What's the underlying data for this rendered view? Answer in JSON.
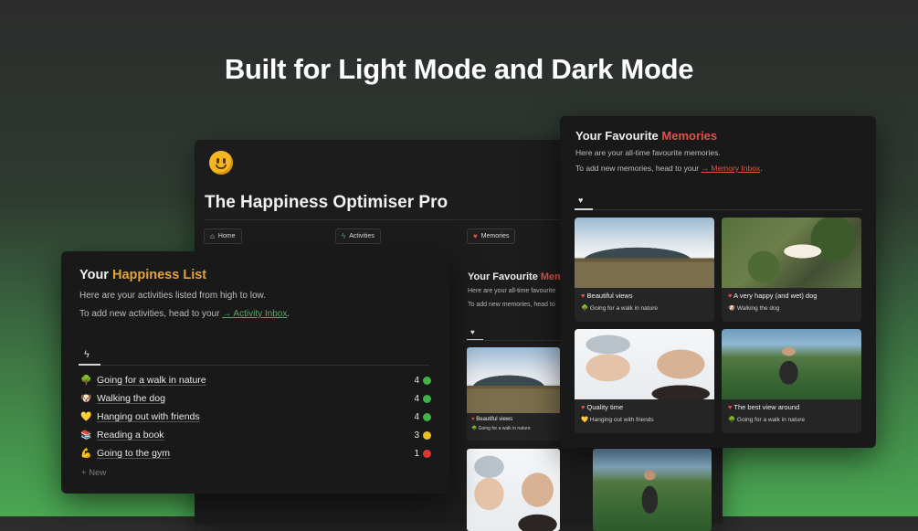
{
  "headline": "Built for Light Mode and Dark Mode",
  "colors": {
    "accent_gold": "#e1a53c",
    "accent_red": "#e0534a",
    "accent_green": "#57a86a"
  },
  "back_window": {
    "icon": "smiley-face-icon",
    "title": "The Happiness Optimiser Pro",
    "tabs": [
      {
        "label": "Home",
        "icon": "home-icon"
      },
      {
        "label": "Activities",
        "icon": "bolt-icon"
      },
      {
        "label": "Memories",
        "icon": "heart-icon"
      }
    ],
    "memories": {
      "title_prefix": "Your Favourite ",
      "title_highlight": "Memo",
      "line1": "Here are your all-time favourite",
      "line2": "To add new memories, head to",
      "card": {
        "title": "Beautiful views",
        "tag": "Going for a walk in nature"
      }
    }
  },
  "happiness_list": {
    "title_prefix": "Your ",
    "title_highlight": "Happiness List",
    "description": "Here are your activities listed from high to low.",
    "instruction_prefix": "To add new activities, head to your ",
    "instruction_link": "→ Activity Inbox",
    "instruction_suffix": ".",
    "items": [
      {
        "emoji": "🌳",
        "name": "Going for a walk in nature",
        "score": "4",
        "status": "green"
      },
      {
        "emoji": "🐶",
        "name": "Walking the dog",
        "score": "4",
        "status": "green"
      },
      {
        "emoji": "💛",
        "name": "Hanging out with friends",
        "score": "4",
        "status": "green"
      },
      {
        "emoji": "📚",
        "name": "Reading a book",
        "score": "3",
        "status": "yellow"
      },
      {
        "emoji": "💪",
        "name": "Going to the gym",
        "score": "1",
        "status": "red"
      }
    ],
    "new_label": "New"
  },
  "memories": {
    "title_prefix": "Your Favourite ",
    "title_highlight": "Memories",
    "description": "Here are your all-time favourite memories.",
    "instruction_prefix": "To add new memories, head to your ",
    "instruction_link": "→ Memory Inbox",
    "instruction_suffix": ".",
    "cards": [
      {
        "title": "Beautiful views",
        "tag_emoji": "🌳",
        "tag": "Going for a walk in nature",
        "photo": "mountain"
      },
      {
        "title": "A very happy (and wet) dog",
        "tag_emoji": "🐶",
        "tag": "Walking the dog",
        "photo": "dog"
      },
      {
        "title": "Quality time",
        "tag_emoji": "💛",
        "tag": "Hanging out with friends",
        "photo": "selfie"
      },
      {
        "title": "The best view around",
        "tag_emoji": "🌳",
        "tag": "Going for a walk in nature",
        "photo": "view"
      }
    ]
  }
}
